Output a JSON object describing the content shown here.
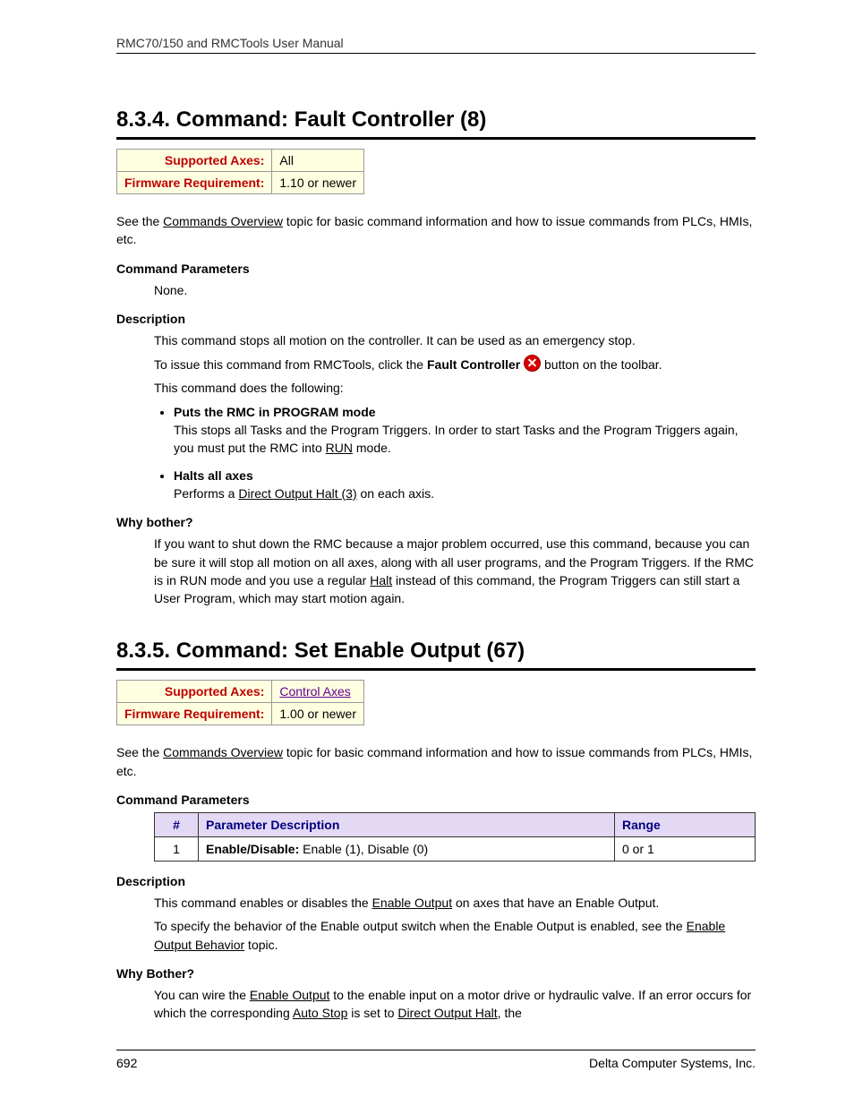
{
  "header": "RMC70/150 and RMCTools User Manual",
  "section834": {
    "title": "8.3.4. Command: Fault Controller (8)",
    "mini": {
      "axes_label": "Supported Axes:",
      "axes_value": "All",
      "fw_label": "Firmware Requirement:",
      "fw_value": "1.10 or newer"
    },
    "intro_pre": "See the ",
    "intro_link": "Commands Overview",
    "intro_post": " topic for basic command information and how to issue commands from PLCs, HMIs, etc.",
    "cmdparams_h": "Command Parameters",
    "cmdparams_none": "None.",
    "desc_h": "Description",
    "desc_p1": "This command stops all motion on the controller. It can be used as an emergency stop.",
    "desc_p2a": "To issue this command from RMCTools, click the ",
    "desc_p2b": "Fault Controller",
    "desc_p2c": " button on the toolbar.",
    "desc_p3": "This command does the following:",
    "b1_t": "Puts the RMC in PROGRAM mode",
    "b1_body_pre": "This stops all Tasks and the Program Triggers. In order to start Tasks and the Program Triggers again, you must put the RMC into ",
    "b1_link": "RUN",
    "b1_body_post": " mode.",
    "b2_t": "Halts all axes",
    "b2_body_pre": "Performs a ",
    "b2_link": "Direct Output Halt (3)",
    "b2_body_post": " on each axis.",
    "why_h": "Why bother?",
    "why_body_pre": "If you want to shut down the RMC because a major problem occurred, use this command, because you can be sure it will stop all motion on all axes, along with all user programs, and the Program Triggers. If the RMC is in RUN mode and you use a regular ",
    "why_link": "Halt",
    "why_body_post": " instead of this command, the Program Triggers can still start a User Program, which may start motion again."
  },
  "section835": {
    "title": "8.3.5. Command: Set Enable Output (67)",
    "mini": {
      "axes_label": "Supported Axes:",
      "axes_link": "Control Axes",
      "fw_label": "Firmware Requirement:",
      "fw_value": "1.00 or newer"
    },
    "intro_pre": "See the ",
    "intro_link": "Commands Overview",
    "intro_post": " topic for basic command information and how to issue commands from PLCs, HMIs, etc.",
    "cmdparams_h": "Command Parameters",
    "table": {
      "h1": "#",
      "h2": "Parameter Description",
      "h3": "Range",
      "r1c1": "1",
      "r1c2a": "Enable/Disable:",
      "r1c2b": " Enable (1), Disable (0)",
      "r1c3": "0 or 1"
    },
    "desc_h": "Description",
    "desc_p1a": "This command enables or disables the ",
    "desc_p1link": "Enable Output",
    "desc_p1b": " on axes that have an Enable Output.",
    "desc_p2a": "To specify the behavior of the Enable output switch when the Enable Output is enabled, see the ",
    "desc_p2link": "Enable Output Behavior",
    "desc_p2b": " topic.",
    "why_h": "Why Bother?",
    "why_p_a": "You can wire the ",
    "why_l1": "Enable Output",
    "why_p_b": " to the enable input on a motor drive or hydraulic valve. If an error occurs for which the corresponding ",
    "why_l2": "Auto Stop",
    "why_p_c": " is set to ",
    "why_l3": "Direct Output Halt",
    "why_p_d": ", the"
  },
  "footer": {
    "page": "692",
    "company": "Delta Computer Systems, Inc."
  }
}
